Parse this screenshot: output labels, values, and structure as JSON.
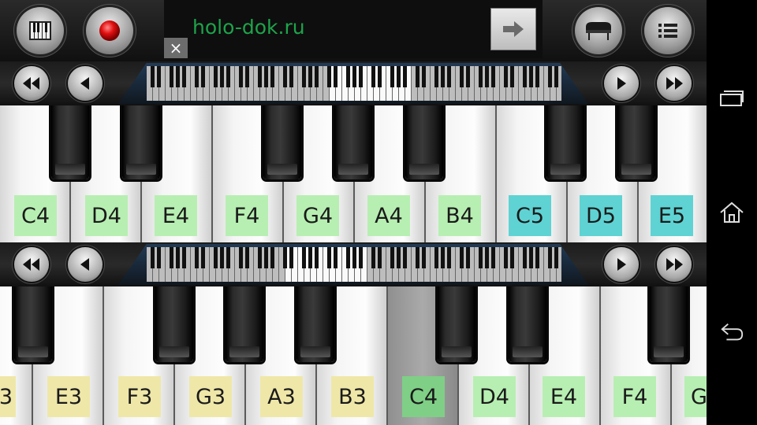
{
  "ad": {
    "text": "holo-dok.ru",
    "close": "×"
  },
  "icons": {
    "keyboard_layout": "piano-keys-icon",
    "record": "record-icon",
    "ad_go": "arrow-right-icon",
    "instrument": "grand-piano-icon",
    "menu": "list-menu-icon",
    "scroll_far_left": "double-chevron-left-icon",
    "scroll_left": "chevron-left-icon",
    "scroll_right": "chevron-right-icon",
    "scroll_far_right": "double-chevron-right-icon",
    "recent_apps": "recent-apps-icon",
    "home": "home-icon",
    "back": "back-icon"
  },
  "colors": {
    "green_label": "#b7efb2",
    "cyan_label": "#5fd3d3",
    "yellow_label": "#efe7a8",
    "c4_label": "#7fcf86",
    "ad_text": "#1ea34a"
  },
  "upper_keyboard": {
    "labels": [
      {
        "text": "C4",
        "color": "green"
      },
      {
        "text": "D4",
        "color": "green"
      },
      {
        "text": "E4",
        "color": "green"
      },
      {
        "text": "F4",
        "color": "green"
      },
      {
        "text": "G4",
        "color": "green"
      },
      {
        "text": "A4",
        "color": "green"
      },
      {
        "text": "B4",
        "color": "green"
      },
      {
        "text": "C5",
        "color": "cyan"
      },
      {
        "text": "D5",
        "color": "cyan"
      },
      {
        "text": "E5",
        "color": "cyan"
      }
    ]
  },
  "lower_keyboard": {
    "labels": [
      {
        "text": "3",
        "color": "yellow"
      },
      {
        "text": "E3",
        "color": "yellow"
      },
      {
        "text": "F3",
        "color": "yellow"
      },
      {
        "text": "G3",
        "color": "yellow"
      },
      {
        "text": "A3",
        "color": "yellow"
      },
      {
        "text": "B3",
        "color": "yellow"
      },
      {
        "text": "C4",
        "color": "c4"
      },
      {
        "text": "D4",
        "color": "green"
      },
      {
        "text": "E4",
        "color": "green"
      },
      {
        "text": "F4",
        "color": "green"
      },
      {
        "text": "G",
        "color": "green"
      }
    ]
  }
}
